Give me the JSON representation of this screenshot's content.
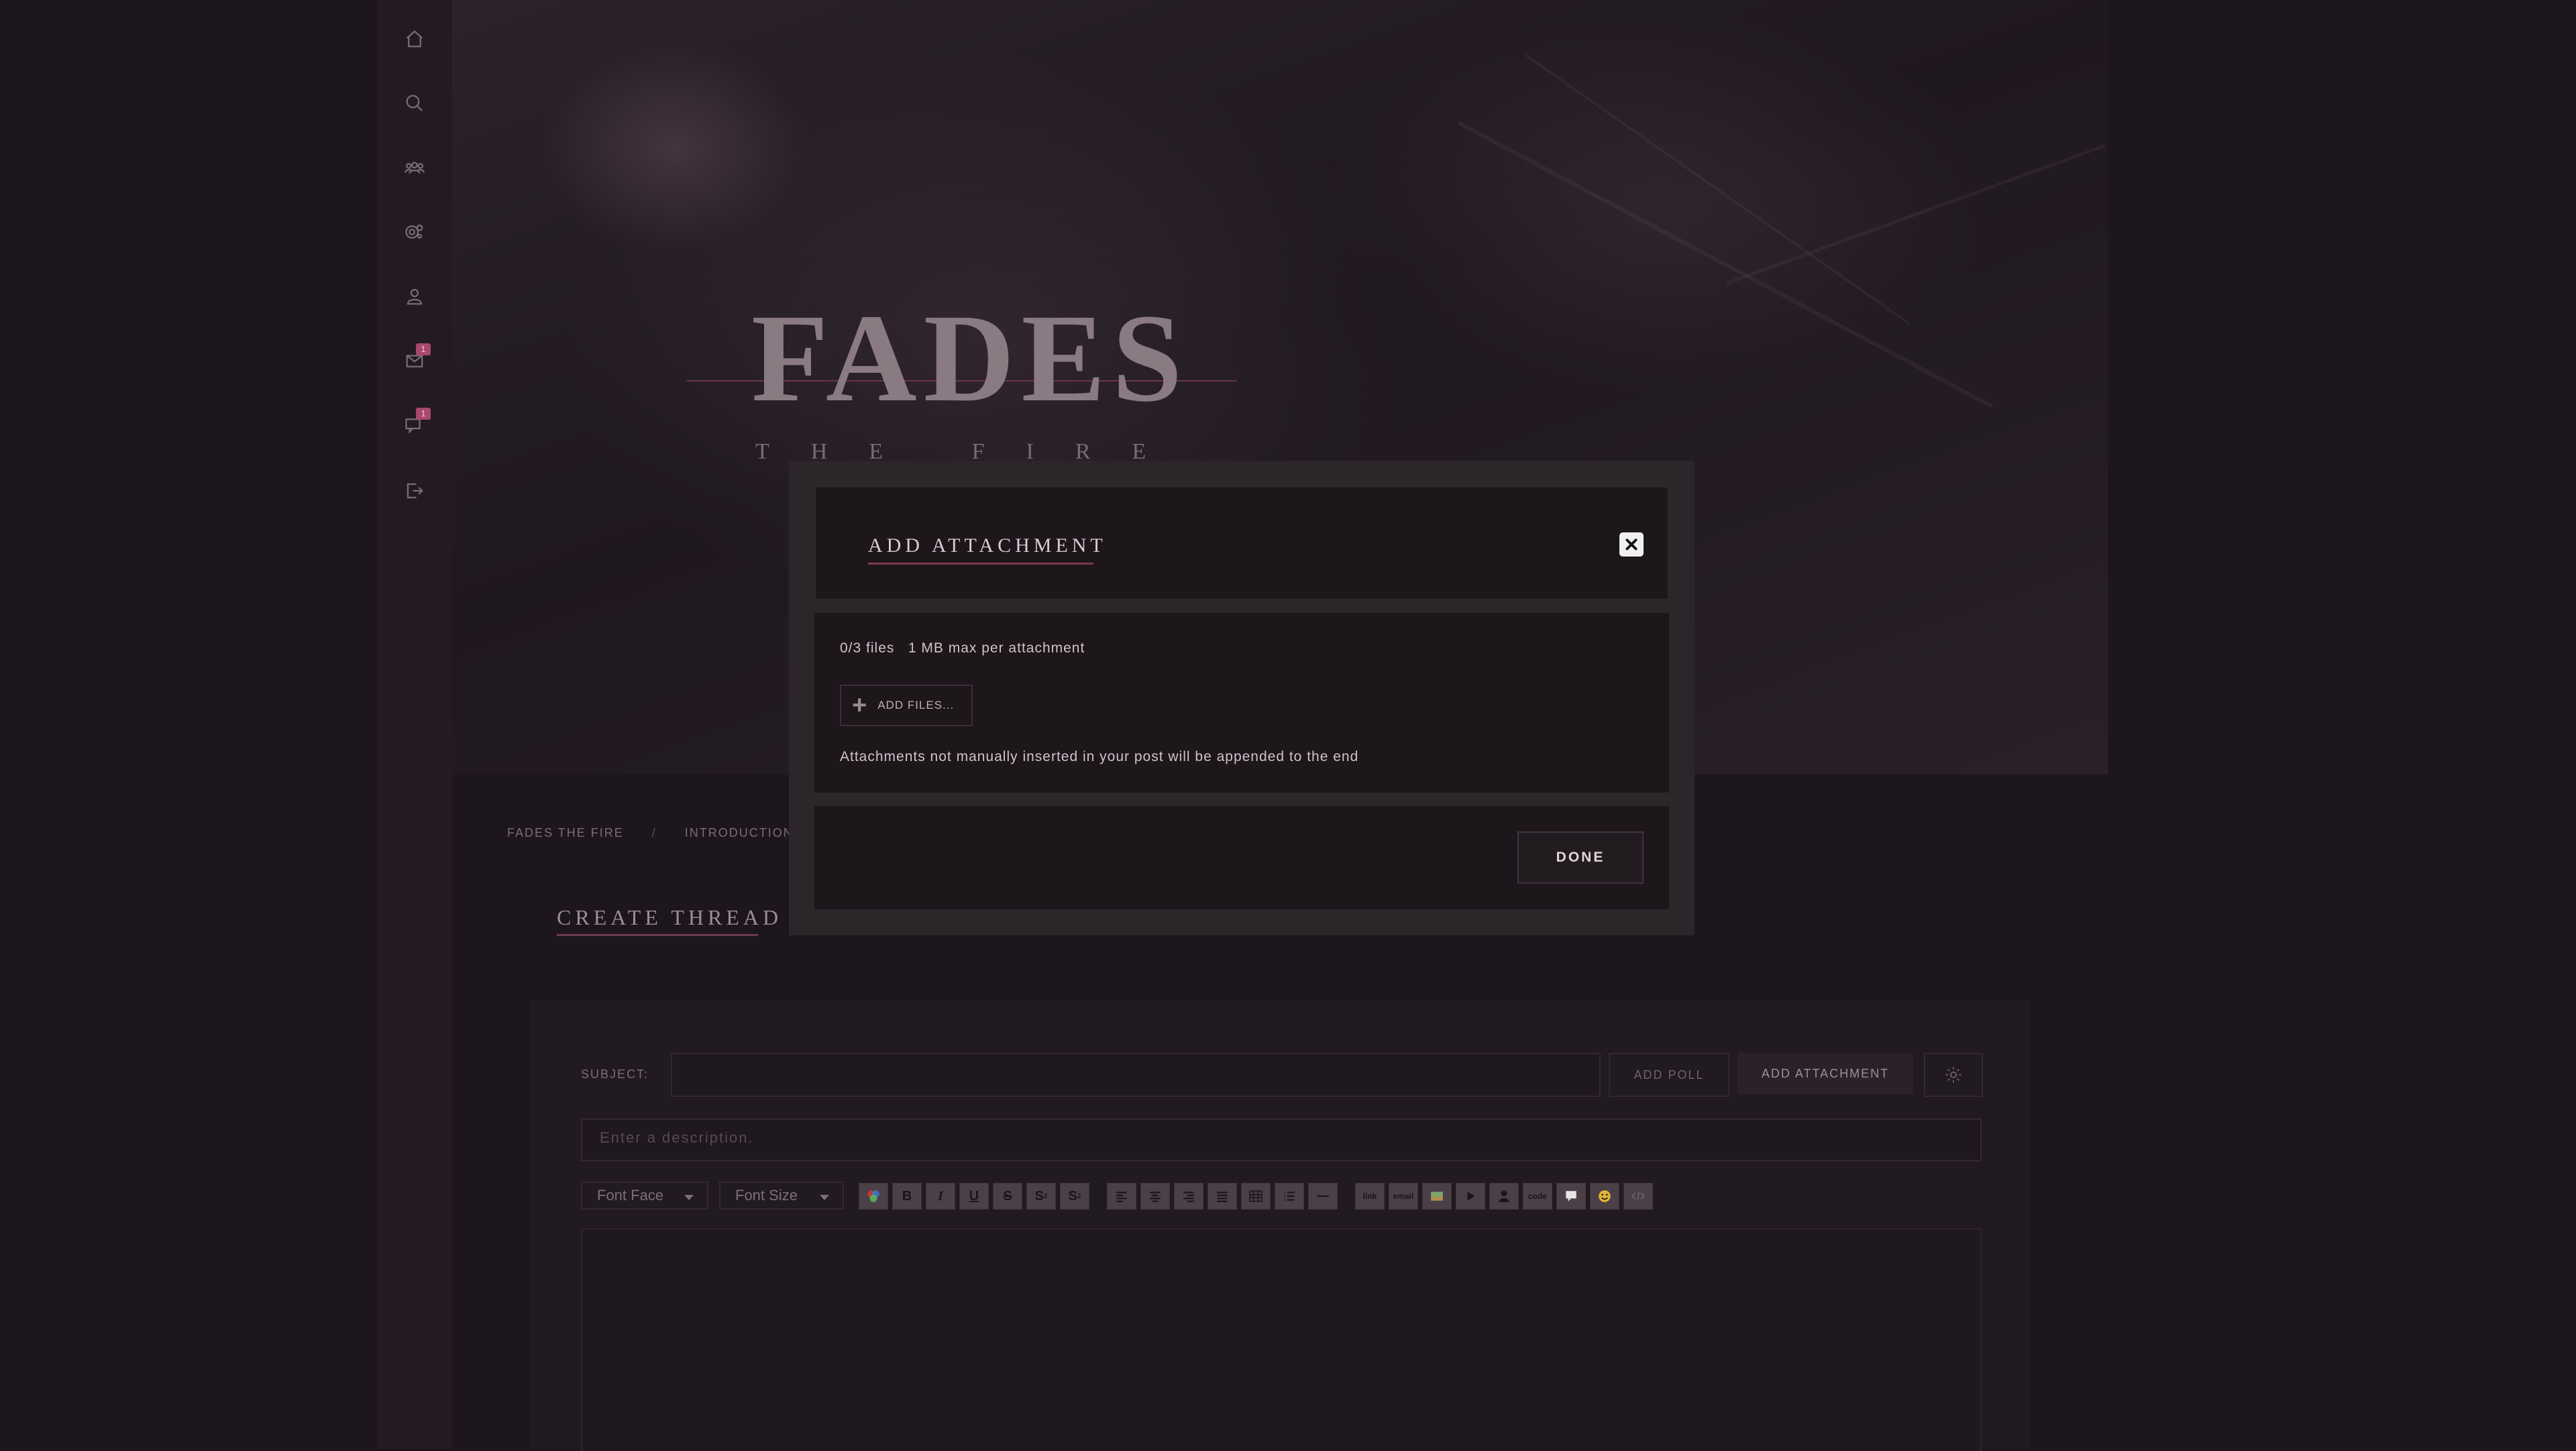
{
  "sidebar": {
    "items": [
      {
        "name": "home-icon",
        "badge": ""
      },
      {
        "name": "search-icon",
        "badge": ""
      },
      {
        "name": "members-icon",
        "badge": ""
      },
      {
        "name": "settings-icon",
        "badge": ""
      },
      {
        "name": "profile-icon",
        "badge": ""
      },
      {
        "name": "mail-icon",
        "badge": "1"
      },
      {
        "name": "chat-icon",
        "badge": "1"
      },
      {
        "name": "logout-icon",
        "badge": ""
      }
    ]
  },
  "header": {
    "logo_title": "FADES",
    "logo_subtitle": "THE FIRE"
  },
  "breadcrumb": {
    "items": [
      "FADES THE FIRE",
      "INTRODUCTION"
    ],
    "separator": "/"
  },
  "page": {
    "title": "CREATE THREAD"
  },
  "editor": {
    "subject_label": "SUBJECT:",
    "subject_value": "",
    "add_poll_label": "ADD POLL",
    "add_attachment_label": "ADD ATTACHMENT",
    "description_placeholder": "Enter a description.",
    "font_face_label": "Font Face",
    "font_size_label": "Font Size",
    "toolbar": {
      "group1": [
        "color-icon",
        "B",
        "I",
        "U",
        "S",
        "S",
        "S"
      ],
      "group2": [
        "align-left-icon",
        "align-center-icon",
        "align-right-icon",
        "justify-icon",
        "table-icon",
        "list-icon",
        "hr-icon"
      ],
      "group3": [
        "link",
        "email",
        "image-icon",
        "video-icon",
        "user-icon",
        "code",
        "quote-icon",
        "emoji-icon",
        "source-icon"
      ]
    }
  },
  "modal": {
    "title": "ADD ATTACHMENT",
    "file_count": "0/3 files",
    "max_size": "1 MB max per attachment",
    "add_files_label": "ADD FILES...",
    "note": "Attachments not manually inserted in your post will be appended to the end",
    "done_label": "DONE"
  },
  "colors": {
    "accent": "#7a3a52",
    "badge": "#a8486c",
    "background": "#1d161c"
  }
}
